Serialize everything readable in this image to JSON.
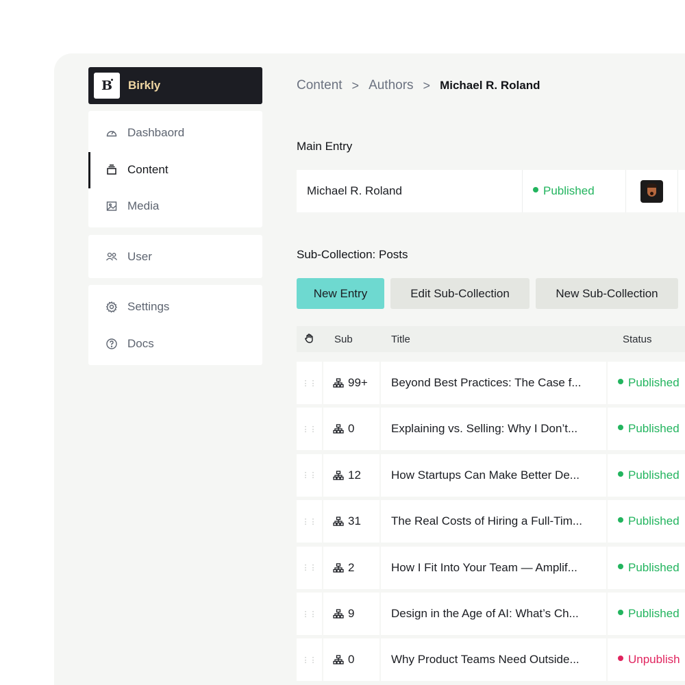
{
  "brand": {
    "logo_letter": "B",
    "name": "Birkly"
  },
  "sidebar": {
    "group1": [
      {
        "label": "Dashbaord",
        "icon": "gauge-icon",
        "active": false
      },
      {
        "label": "Content",
        "icon": "layers-icon",
        "active": true
      },
      {
        "label": "Media",
        "icon": "image-icon",
        "active": false
      }
    ],
    "group2": [
      {
        "label": "User",
        "icon": "users-icon"
      }
    ],
    "group3": [
      {
        "label": "Settings",
        "icon": "gear-icon"
      },
      {
        "label": "Docs",
        "icon": "help-circle-icon"
      }
    ]
  },
  "breadcrumb": {
    "items": [
      "Content",
      "Authors",
      "Michael R. Roland"
    ],
    "separator": ">"
  },
  "main_entry": {
    "title": "Main Entry",
    "name": "Michael R. Roland",
    "status": "Published",
    "avatar_icon": "author-avatar"
  },
  "sub_collection": {
    "title": "Sub-Collection: Posts",
    "buttons": {
      "new_entry": "New Entry",
      "edit_sub_collection": "Edit Sub-Collection",
      "new_sub_collection": "New Sub-Collection"
    },
    "columns": {
      "drag_icon": "hand-icon",
      "sub": "Sub",
      "title": "Title",
      "status": "Status"
    },
    "rows": [
      {
        "sub": "99+",
        "title": "Beyond Best Practices: The Case f...",
        "status": "Published"
      },
      {
        "sub": "0",
        "title": "Explaining vs. Selling: Why I Don’t...",
        "status": "Published"
      },
      {
        "sub": "12",
        "title": "How Startups Can Make Better De...",
        "status": "Published"
      },
      {
        "sub": "31",
        "title": "The Real Costs of Hiring a Full-Tim...",
        "status": "Published"
      },
      {
        "sub": "2",
        "title": "How I Fit Into Your Team — Amplif...",
        "status": "Published"
      },
      {
        "sub": "9",
        "title": "Design in the Age of AI: What’s Ch...",
        "status": "Published"
      },
      {
        "sub": "0",
        "title": "Why Product Teams Need Outside...",
        "status": "Unpublish"
      }
    ]
  },
  "colors": {
    "published": "#22b45e",
    "unpublished": "#e0245e",
    "primary_button": "#6ed9d0",
    "brand_bar": "#1c1d23",
    "brand_text": "#f1d8a4"
  }
}
